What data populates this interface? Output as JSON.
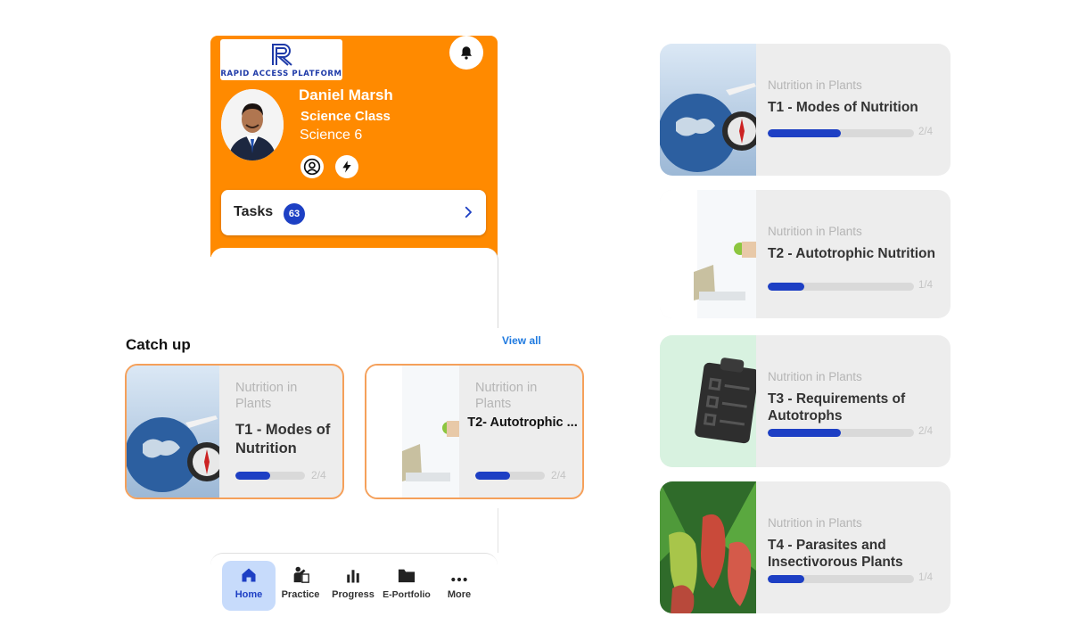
{
  "brand": {
    "logo_text": "RAPID ACCESS PLATFORM",
    "accent": "#FF8A00",
    "primary": "#1D3FC4"
  },
  "profile": {
    "name": "Daniel Marsh",
    "class_name": "Science Class",
    "subject": "Science 6"
  },
  "tasks": {
    "label": "Tasks",
    "count": "63"
  },
  "catch_up": {
    "title": "Catch up",
    "view_all": "View all",
    "cards": [
      {
        "subject": "Nutrition in Plants",
        "title": "T1 - Modes of Nutrition",
        "progress": "2/4",
        "progress_fraction": 0.5
      },
      {
        "subject": "Nutrition in Plants",
        "title": "T2- Autotrophic ...",
        "progress": "2/4",
        "progress_fraction": 0.5
      }
    ]
  },
  "nav": {
    "items": [
      {
        "label": "Home",
        "icon": "home-icon",
        "active": true
      },
      {
        "label": "Practice",
        "icon": "practice-icon",
        "active": false
      },
      {
        "label": "Progress",
        "icon": "bar-chart-icon",
        "active": false
      },
      {
        "label": "E-Portfolio",
        "icon": "folder-icon",
        "active": false
      },
      {
        "label": "More",
        "icon": "more-dots-icon",
        "active": false
      }
    ]
  },
  "lessons": [
    {
      "subject": "Nutrition in Plants",
      "title": "T1 - Modes of Nutrition",
      "progress": "2/4",
      "progress_fraction": 0.5
    },
    {
      "subject": "Nutrition in Plants",
      "title": "T2 - Autotrophic Nutrition",
      "progress": "1/4",
      "progress_fraction": 0.25
    },
    {
      "subject": "Nutrition in Plants",
      "title": "T3 - Requirements of Autotrophs",
      "progress": "2/4",
      "progress_fraction": 0.5
    },
    {
      "subject": "Nutrition in Plants",
      "title": "T4 - Parasites and Insectivorous Plants",
      "progress": "1/4",
      "progress_fraction": 0.25
    }
  ]
}
